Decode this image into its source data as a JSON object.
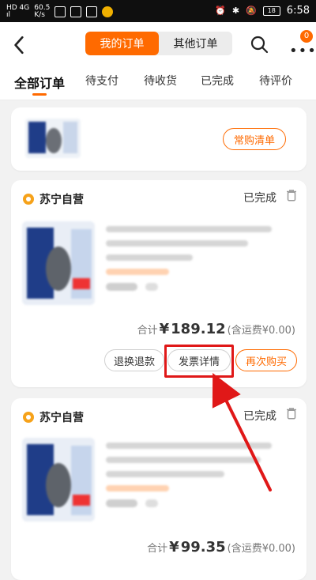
{
  "status_bar": {
    "left_text": "60.5",
    "left_unit": "K/s",
    "time": "6:58",
    "battery": "18"
  },
  "header": {
    "segments": [
      "我的订单",
      "其他订单"
    ],
    "active_segment": 0,
    "badge_count": "0",
    "icons": [
      "back-icon",
      "search-icon",
      "more-icon"
    ]
  },
  "filters": [
    "全部订单",
    "待支付",
    "待收货",
    "已完成",
    "待评价"
  ],
  "favorites_card": {
    "button_label": "常购清单"
  },
  "orders": [
    {
      "store": "苏宁自营",
      "status": "已完成",
      "total_label": "合计",
      "currency": "¥",
      "total_amount": "189.12",
      "shipping_note": "(含运费¥0.00)",
      "buttons": [
        "退换退款",
        "发票详情",
        "再次购买"
      ]
    },
    {
      "store": "苏宁自营",
      "status": "已完成",
      "total_label": "合计",
      "currency": "¥",
      "total_amount": "99.35",
      "shipping_note": "(含运费¥0.00)"
    }
  ],
  "colors": {
    "accent": "#ff6a00",
    "highlight": "#e01818"
  }
}
